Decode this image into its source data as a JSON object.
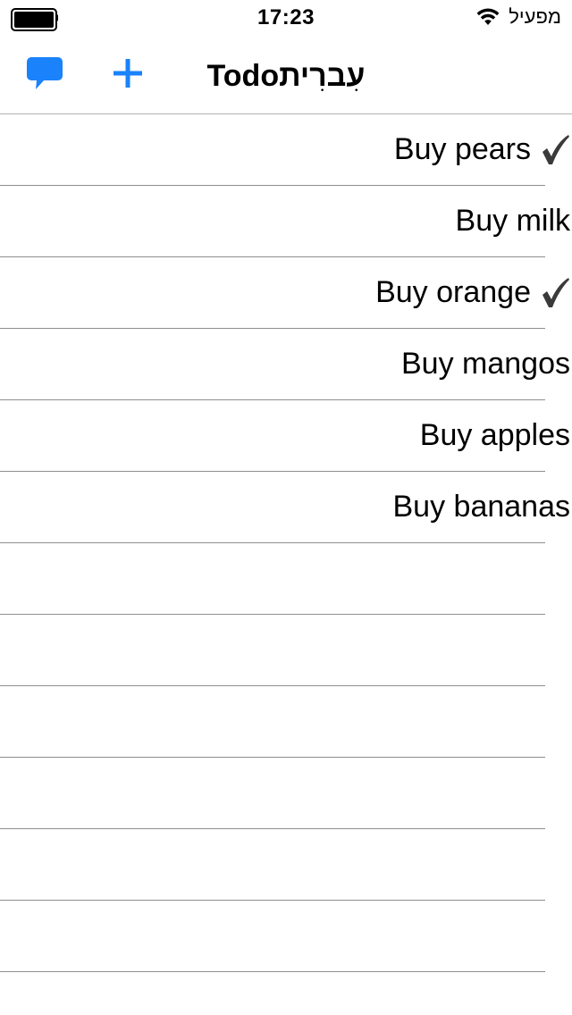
{
  "status_bar": {
    "time": "17:23",
    "carrier": "מפעיל",
    "battery_level": 1.0,
    "icons": [
      "battery-icon",
      "wifi-icon"
    ]
  },
  "nav": {
    "title": "Todoעִברִית",
    "left_buttons": [
      {
        "icon": "comment-icon"
      },
      {
        "icon": "plus-icon"
      }
    ],
    "accent_color": "#1a82fb"
  },
  "todos": [
    {
      "label": "Buy pears",
      "done": true
    },
    {
      "label": "Buy milk",
      "done": false
    },
    {
      "label": "Buy orange",
      "done": true
    },
    {
      "label": "Buy mangos",
      "done": false
    },
    {
      "label": "Buy apples",
      "done": false
    },
    {
      "label": "Buy bananas",
      "done": false
    }
  ],
  "empty_rows": 6,
  "check_color": "#3a3a3a",
  "separator_color": "#8e8e8e"
}
